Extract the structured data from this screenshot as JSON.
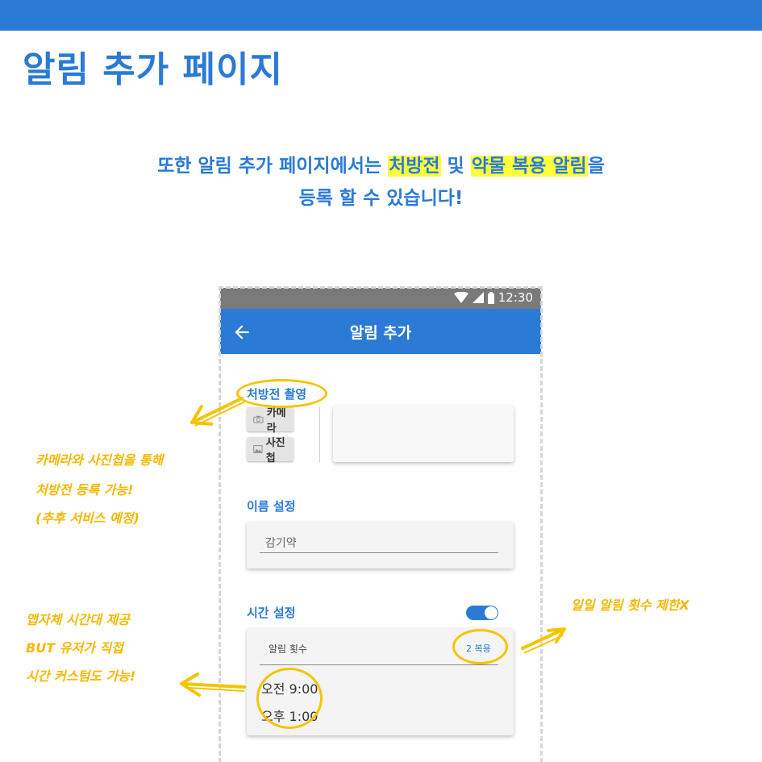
{
  "slide": {
    "title": "알림 추가 페이지",
    "intro_line1_pre": "또한 알림 추가 페이지에서는 ",
    "intro_hl1": "처방전",
    "intro_mid": " 및 ",
    "intro_hl2": "약물 복용 알림",
    "intro_post": "을",
    "intro_line2": "등록 할 수 있습니다!"
  },
  "phone": {
    "status_time": "12:30",
    "app_title": "알림 추가",
    "prescription_label": "처방전 촬영",
    "camera_button": "카메라",
    "gallery_button": "사진첩",
    "name_label": "이름 설정",
    "name_value": "감기약",
    "time_label": "시간 설정",
    "time_toggle_on": true,
    "alarm_count_label": "알림 횟수",
    "alarm_count_value": "2 복용",
    "times": [
      "오전 9:00",
      "오후 1:00"
    ]
  },
  "annotations": {
    "left_top": [
      "카메라와 사진첩을 통해",
      "처방전 등록 가능!",
      "(추후 서비스 예정)"
    ],
    "left_bottom": [
      "앱자체 시간대 제공",
      "BUT 유저가 직접",
      "시간 커스텀도 가능!"
    ],
    "right": "일일 알림 횟수 제한X"
  },
  "colors": {
    "brand": "#2a7ad6",
    "highlight": "#ffff3c",
    "annotation": "#f5b800"
  }
}
